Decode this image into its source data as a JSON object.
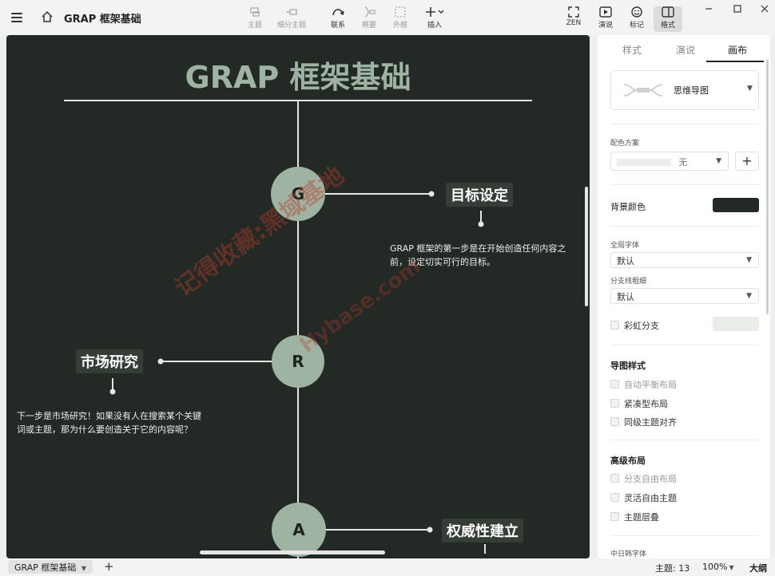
{
  "topbar": {
    "doc_title": "GRAP 框架基础",
    "tools": [
      {
        "id": "topic",
        "label": "主题"
      },
      {
        "id": "subtopic",
        "label": "细分主题"
      },
      {
        "id": "relation",
        "label": "联系"
      },
      {
        "id": "summary",
        "label": "概要"
      },
      {
        "id": "boundary",
        "label": "外框"
      },
      {
        "id": "insert",
        "label": "插入"
      }
    ],
    "right_tools": [
      {
        "id": "zen",
        "label": "ZEN"
      },
      {
        "id": "pitch",
        "label": "演说"
      },
      {
        "id": "marker",
        "label": "标记"
      },
      {
        "id": "format",
        "label": "格式"
      }
    ]
  },
  "canvas": {
    "title": "GRAP 框架基础",
    "bg_color": "#232a25",
    "accent_color": "#9fb3a3",
    "nodes": [
      {
        "letter": "G",
        "topic": "目标设定",
        "desc_line1": "GRAP 框架的第一步是在开始创造任何内容之",
        "desc_line2": "前，设定切实可行的目标。"
      },
      {
        "letter": "R",
        "topic": "市场研究",
        "desc_line1": "下一步是市场研究！如果没有人在搜索某个关键",
        "desc_line2": "词或主题，那为什么要创造关于它的内容呢？"
      },
      {
        "letter": "A",
        "topic": "权威性建立"
      }
    ],
    "watermark_line1": "记得收藏:黑域基地",
    "watermark_line2": "Hybase.com"
  },
  "panel": {
    "tabs": [
      "样式",
      "演说",
      "画布"
    ],
    "selected_tab": "画布",
    "structure_label": "思维导图",
    "color_scheme_label": "配色方案",
    "color_scheme_value": "无",
    "bg_color_label": "背景颜色",
    "bg_color_value": "#232a25",
    "global_font_label": "全局字体",
    "global_font_value": "默认",
    "branch_width_label": "分支线粗细",
    "branch_width_value": "默认",
    "rainbow_branch_label": "彩虹分支",
    "map_style_label": "导图样式",
    "map_style_options": [
      "自动平衡布局",
      "紧凑型布局",
      "同级主题对齐"
    ],
    "advanced_layout_label": "高级布局",
    "advanced_layout_options": [
      "分支自由布局",
      "灵活自由主题",
      "主题层叠"
    ],
    "cjk_font_label": "中日韩字体"
  },
  "bottombar": {
    "sheet_tab": "GRAP 框架基础",
    "topic_count": "主题: 13",
    "zoom": "100%",
    "outline": "大纲"
  }
}
